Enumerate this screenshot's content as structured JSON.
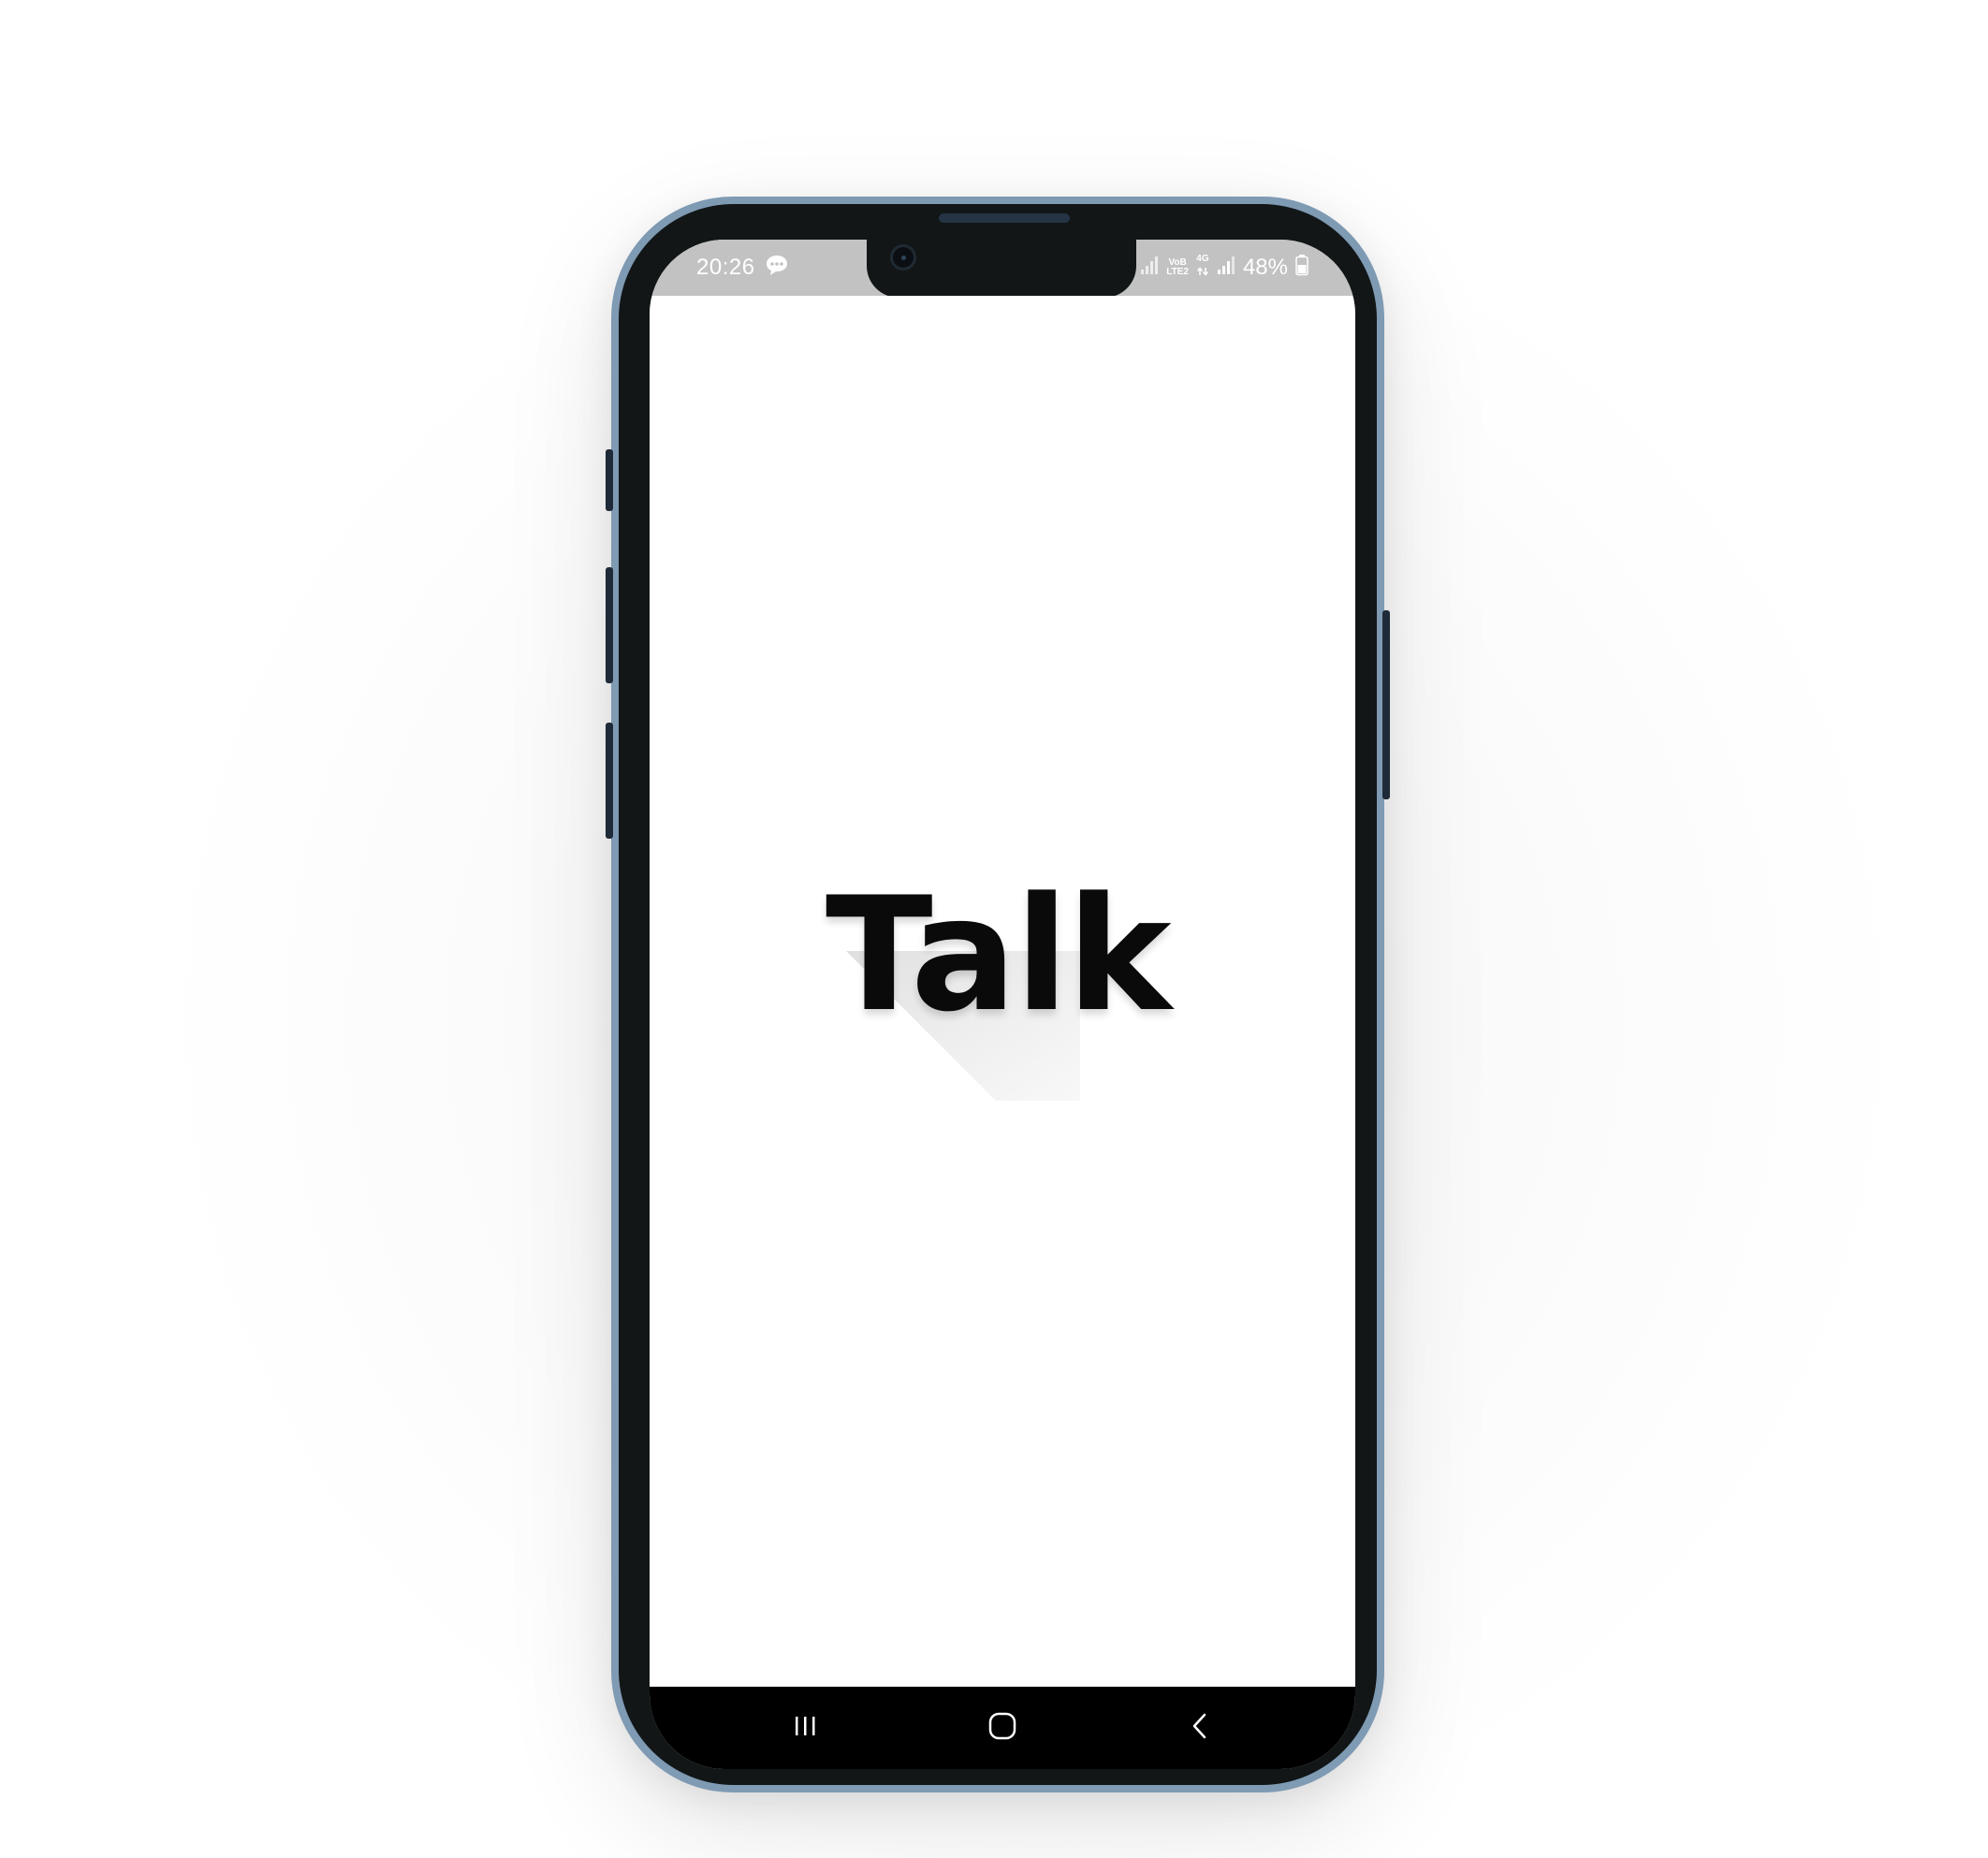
{
  "status_bar": {
    "time": "20:26",
    "notification_icon": "message-icon",
    "network_volte_top": "VoB",
    "network_volte_bottom": "LTE2",
    "network_type": "4G",
    "battery": "48%"
  },
  "app": {
    "logo_text": "Talk"
  },
  "nav_bar": {
    "recents_icon": "recents-icon",
    "home_icon": "home-icon",
    "back_icon": "back-icon"
  },
  "colors": {
    "status_bar_bg": "#c2c2c2",
    "frame": "#7f9ab3",
    "bezel": "#121617",
    "nav_bar_bg": "#000000",
    "logo": "#0a0a0a"
  }
}
